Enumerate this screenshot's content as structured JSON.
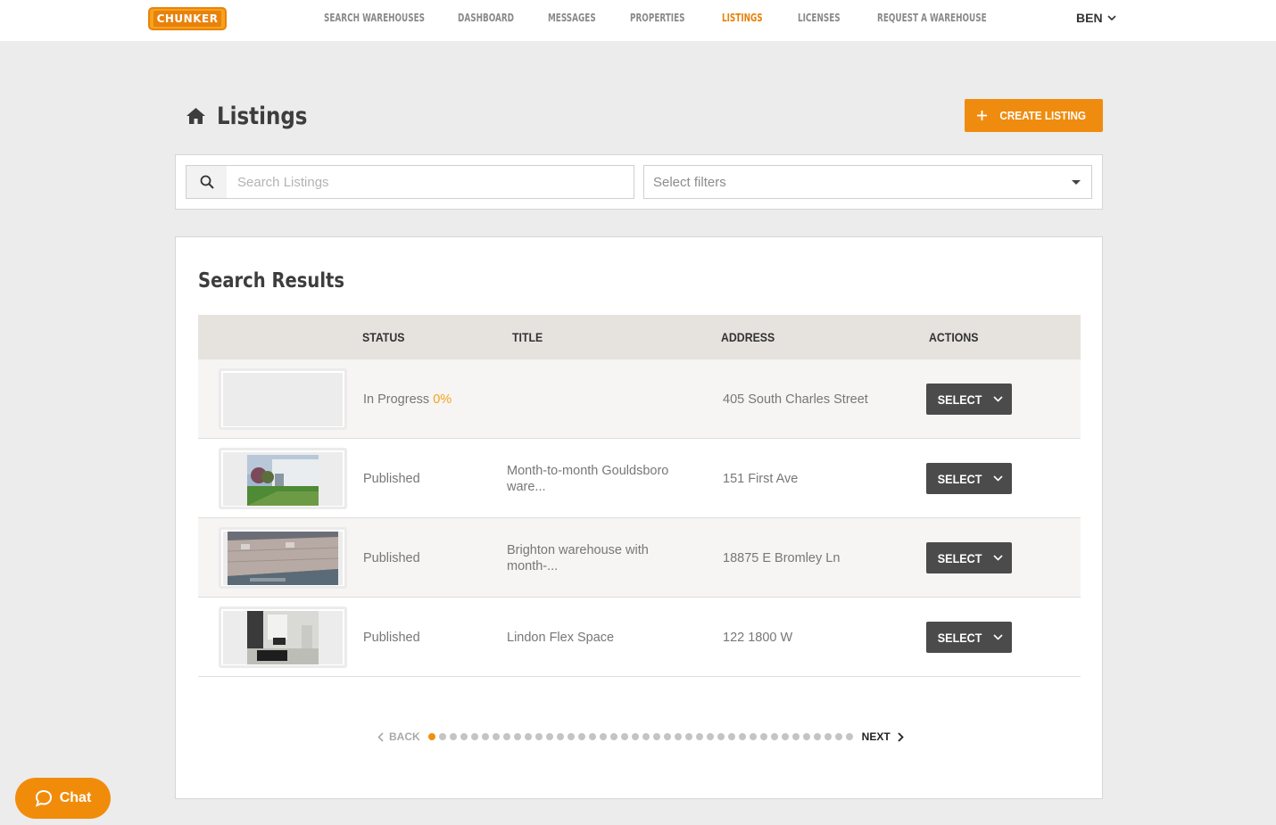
{
  "header": {
    "logo_text": "CHUNKER",
    "nav": [
      {
        "label": "SEARCH WAREHOUSES",
        "active": false
      },
      {
        "label": "DASHBOARD",
        "active": false
      },
      {
        "label": "MESSAGES",
        "active": false
      },
      {
        "label": "PROPERTIES",
        "active": false
      },
      {
        "label": "LISTINGS",
        "active": true
      },
      {
        "label": "LICENSES",
        "active": false
      },
      {
        "label": "REQUEST A WAREHOUSE",
        "active": false
      }
    ],
    "user_name": "BEN"
  },
  "page": {
    "title": "Listings",
    "create_button": "CREATE LISTING"
  },
  "search": {
    "placeholder": "Search Listings",
    "filter_placeholder": "Select filters"
  },
  "results": {
    "title": "Search Results",
    "columns": {
      "status": "STATUS",
      "title": "TITLE",
      "address": "ADDRESS",
      "actions": "ACTIONS"
    },
    "rows": [
      {
        "status": "In Progress",
        "progress": "0%",
        "title": "",
        "address": "405 South Charles Street",
        "action": "SELECT"
      },
      {
        "status": "Published",
        "progress": "",
        "title": "Month-to-month Gouldsboro ware...",
        "address": "151 First Ave",
        "action": "SELECT"
      },
      {
        "status": "Published",
        "progress": "",
        "title": "Brighton warehouse with month-...",
        "address": "18875 E Bromley Ln",
        "action": "SELECT"
      },
      {
        "status": "Published",
        "progress": "",
        "title": "Lindon Flex Space",
        "address": "122 1800 W",
        "action": "SELECT"
      }
    ]
  },
  "pagination": {
    "back_label": "BACK",
    "next_label": "NEXT",
    "total_pages": 40,
    "current_page": 1
  },
  "chat": {
    "label": "Chat"
  },
  "colors": {
    "accent": "#ef8c0f",
    "button_dark": "#4b4b4b",
    "header_row": "#e6e3df"
  }
}
